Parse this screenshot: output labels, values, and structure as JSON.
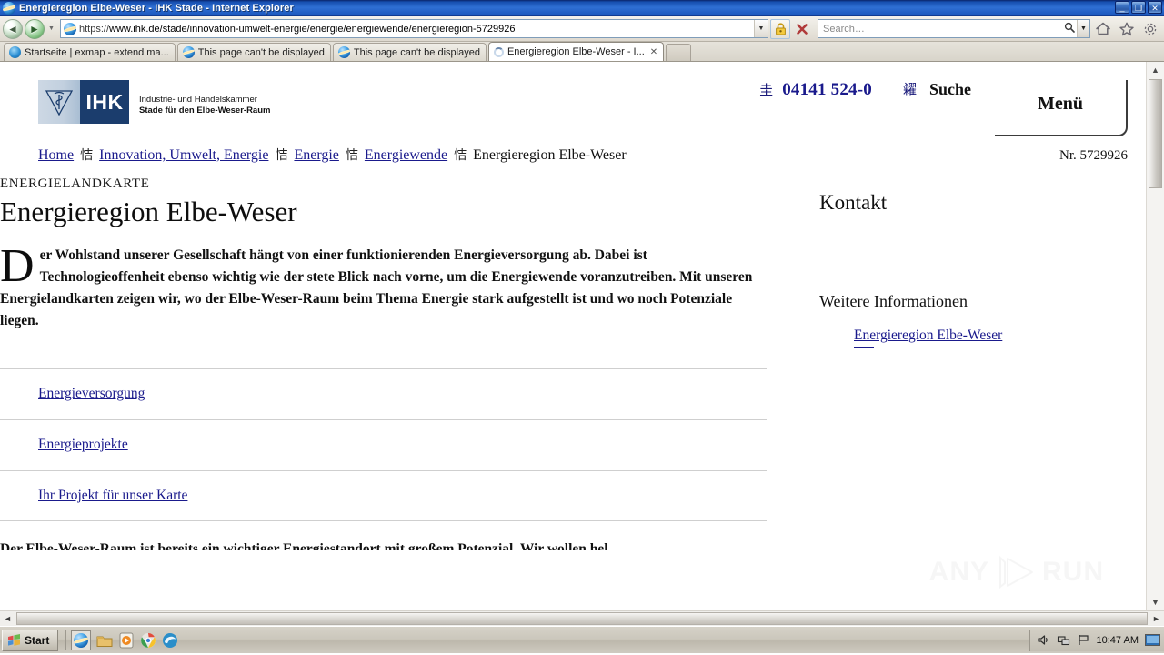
{
  "window": {
    "title": "Energieregion Elbe-Weser - IHK Stade - Internet Explorer",
    "minimize_label": "_",
    "restore_label": "❐",
    "close_label": "✕"
  },
  "toolbar": {
    "back_label": "◄",
    "forward_label": "►",
    "history_label": "▼",
    "url_scheme": "https://",
    "url_rest": "www.ihk.de/stade/innovation-umwelt-energie/energie/energiewende/energieregion-5729926",
    "go_drop_label": "▼",
    "lock_label": "🔒",
    "stop_label": "✕",
    "search_placeholder": "Search…",
    "search_value": "",
    "search_mag_label": "⌕",
    "search_drop_label": "▼",
    "home_label": "⌂",
    "favorites_label": "☆",
    "settings_label": "⚙"
  },
  "tabs": [
    {
      "label": "Startseite | exmap - extend ma...",
      "icon": "exmap-globe-icon",
      "active": false,
      "closable": false
    },
    {
      "label": "This page can't be displayed",
      "icon": "ie-icon",
      "active": false,
      "closable": false
    },
    {
      "label": "This page can't be displayed",
      "icon": "ie-icon",
      "active": false,
      "closable": false
    },
    {
      "label": "Energieregion Elbe-Weser - I...",
      "icon": "loading-spinner-icon",
      "active": true,
      "closable": true,
      "close_label": "✕"
    }
  ],
  "site": {
    "logo": {
      "mark_text": "IHK",
      "line1": "Industrie- und Handelskammer",
      "line2": "Stade für den Elbe-Weser-Raum"
    },
    "header": {
      "phone_icon_glyph": "圭",
      "phone": "04141 524-0",
      "search_icon_glyph": "糴",
      "search_label": "Suche",
      "menu_label": "Menü"
    },
    "breadcrumb": {
      "separator_glyph": "恄",
      "items": [
        {
          "label": "Home",
          "link": true
        },
        {
          "label": "Innovation, Umwelt, Energie",
          "link": true
        },
        {
          "label": "Energie",
          "link": true
        },
        {
          "label": "Energiewende",
          "link": true
        },
        {
          "label": "Energieregion Elbe-Weser",
          "link": false
        }
      ],
      "number": "Nr. 5729926"
    },
    "main": {
      "kicker": "ENERGIELANDKARTE",
      "title": "Energieregion Elbe-Weser",
      "intro_dropcap": "D",
      "intro_text": "er Wohlstand unserer Gesellschaft hängt von einer funktionierenden Energieversorgung ab. Dabei ist Technologieoffenheit ebenso wichtig wie der stete Blick nach vorne, um die Energiewende voranzutreiben. Mit unseren Energielandkarten zeigen wir, wo der Elbe-Weser-Raum beim Thema Energie stark aufgestellt ist und wo noch Potenziale liegen.",
      "accordion": [
        {
          "label": "Energieversorgung"
        },
        {
          "label": "Energieprojekte"
        },
        {
          "label": "Ihr Projekt für unser Karte"
        }
      ],
      "clipped_line": "Der Elbe-Weser-Raum ist bereits ein wichtiger Energiestandort mit großem Potenzial. Wir wollen hel"
    },
    "sidebar": {
      "kontakt_heading": "Kontakt",
      "weitere_heading": "Weitere Informationen",
      "links": [
        {
          "label": "Energieregion Elbe-Weser"
        }
      ]
    },
    "watermark": "ANY RUN"
  },
  "scrollbars": {
    "up_label": "▲",
    "down_label": "▼",
    "left_label": "◄",
    "right_label": "►"
  },
  "taskbar": {
    "start_label": "Start",
    "quicklaunch": [
      {
        "name": "internet-explorer-icon",
        "active": true
      },
      {
        "name": "folder-explorer-icon",
        "active": false
      },
      {
        "name": "media-player-icon",
        "active": false
      },
      {
        "name": "chrome-icon",
        "active": false
      },
      {
        "name": "edge-icon",
        "active": false
      }
    ],
    "tray": {
      "volume_label": "🔊",
      "network_label": "🖧",
      "flag_label": "⚑",
      "clock": "10:47 AM"
    }
  },
  "colors": {
    "titlebar_blue": "#1b58bd",
    "link_blue": "#1a1a8c",
    "logo_navy": "#1b3d6d",
    "logo_light": "#c2d0df"
  }
}
